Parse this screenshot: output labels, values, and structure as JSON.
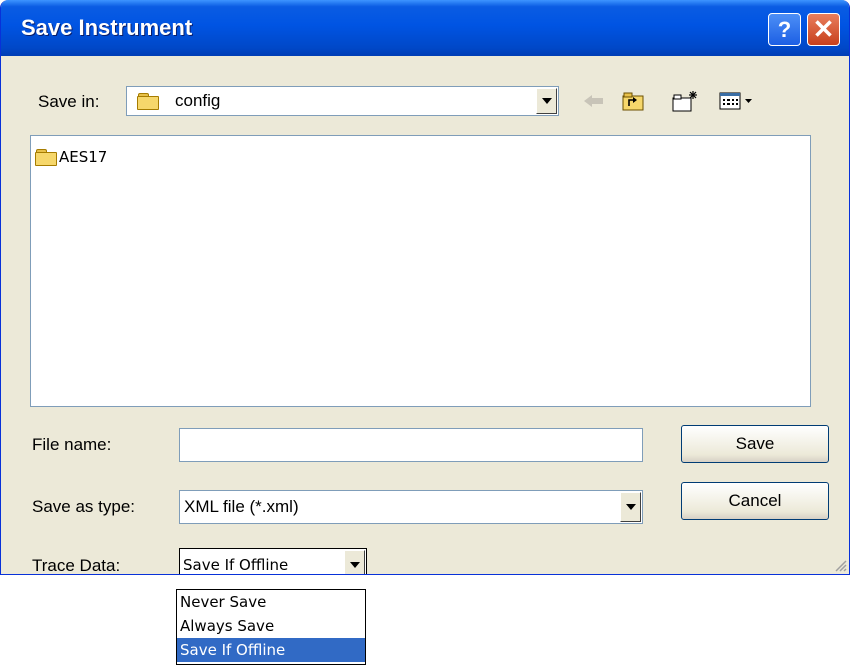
{
  "window": {
    "title": "Save Instrument",
    "help_label": "?",
    "close_label": "✕"
  },
  "save_in": {
    "label": "Save in:",
    "value": "config"
  },
  "file_list": {
    "items": [
      {
        "name": "AES17",
        "icon": "folder-icon"
      }
    ]
  },
  "file_name": {
    "label": "File name:",
    "value": ""
  },
  "save_as_type": {
    "label": "Save as type:",
    "value": "XML file (*.xml)"
  },
  "trace_data": {
    "label": "Trace Data:",
    "value": "Save If Offline",
    "options": [
      "Never Save",
      "Always Save",
      "Save If Offline"
    ],
    "selected_index": 2
  },
  "buttons": {
    "save": "Save",
    "cancel": "Cancel"
  },
  "colors": {
    "titlebar": "#0054e3",
    "dialog_bg": "#ece9d8",
    "selection": "#316ac5"
  }
}
